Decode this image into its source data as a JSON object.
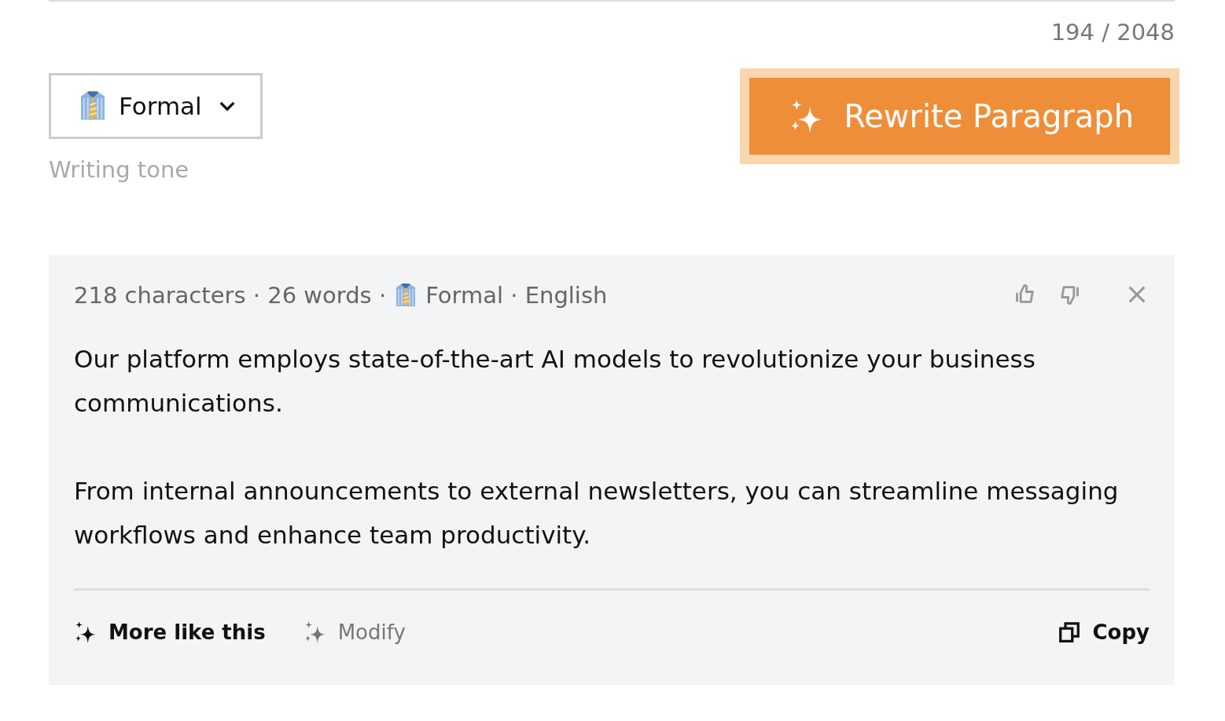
{
  "counter": "194 / 2048",
  "tone_dropdown": {
    "value": "Formal",
    "label": "Writing tone"
  },
  "rewrite_button": {
    "label": "Rewrite Paragraph",
    "focused": true
  },
  "result": {
    "meta_lead": "218 characters · 26 words ·",
    "meta_tail": "Formal · English",
    "paragraphs": [
      "Our platform employs state-of-the-art AI models to revolutionize your business communications.",
      "From internal announcements to external newsletters, you can streamline messaging workflows and enhance team productivity."
    ],
    "actions": [
      {
        "kind": "sparkle",
        "label": "More like this",
        "disabled": false
      },
      {
        "kind": "sparkle",
        "label": "Modify",
        "disabled": true
      },
      {
        "kind": "copy",
        "label": "Copy",
        "disabled": false
      }
    ]
  }
}
